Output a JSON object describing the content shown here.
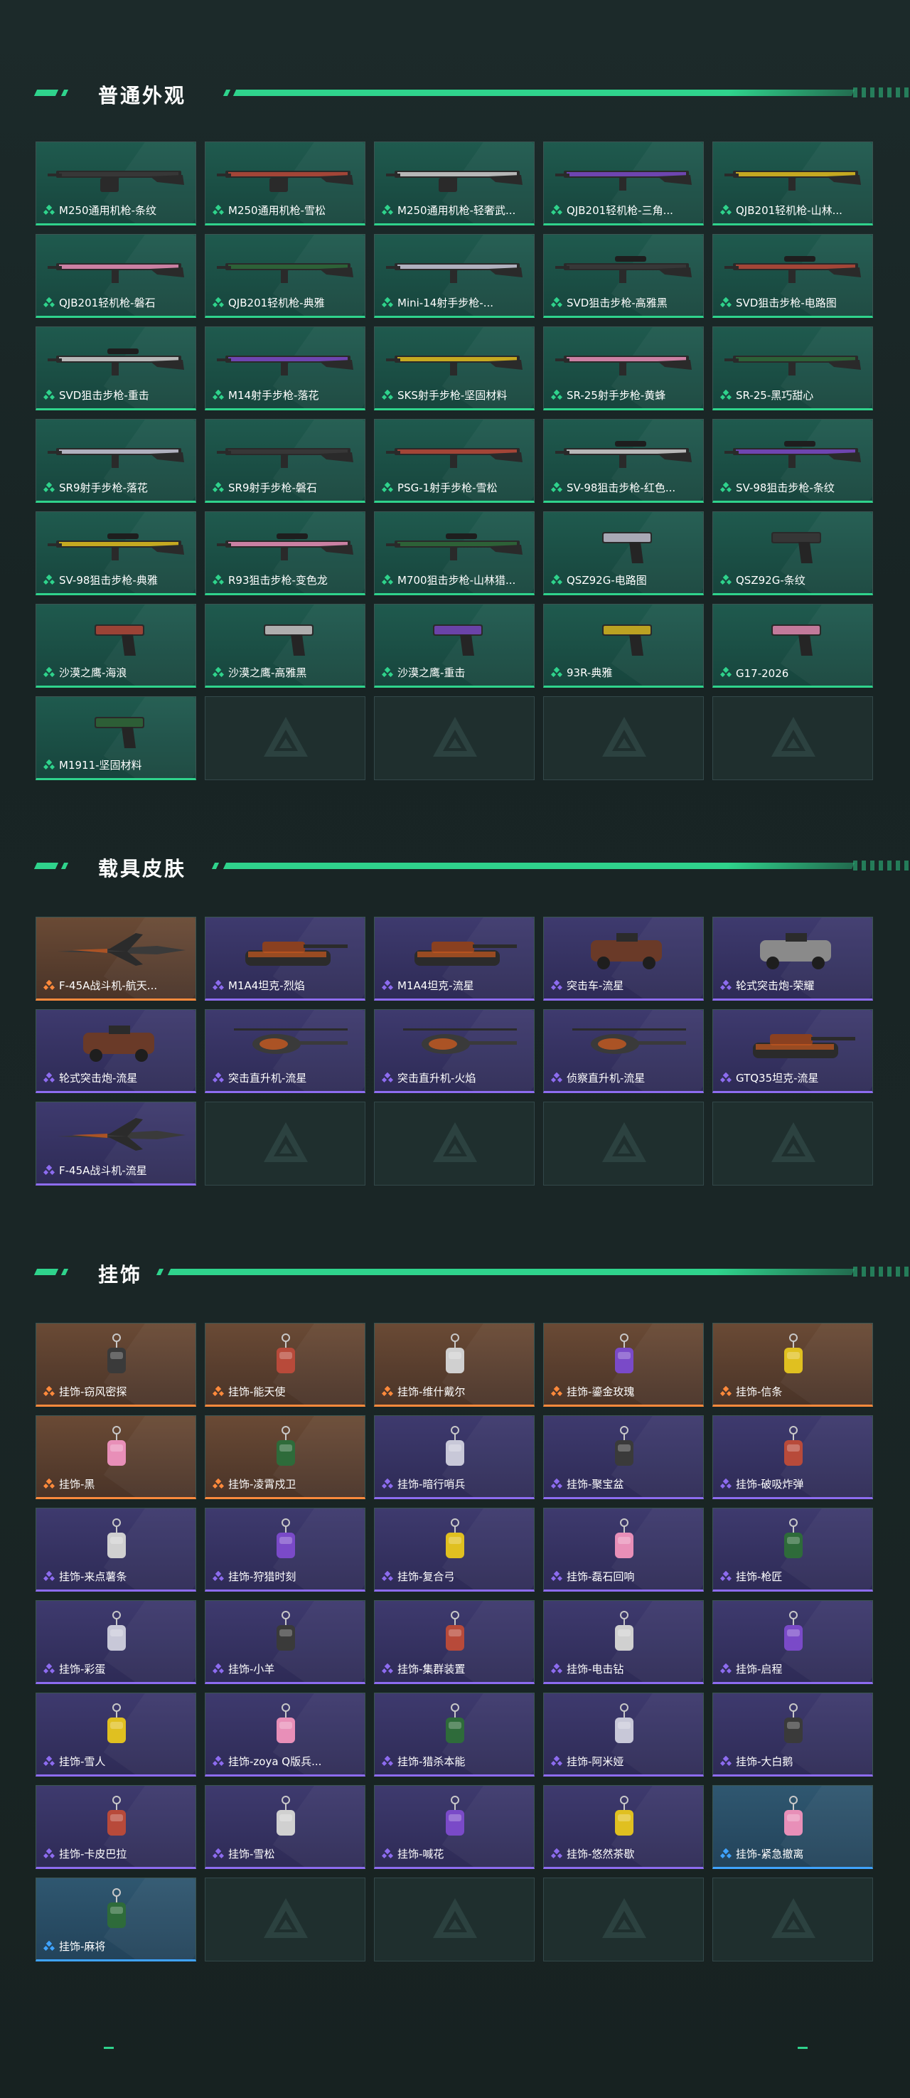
{
  "colors": {
    "accent": "#2fd38c",
    "green_card": "#1f5a4e",
    "purple_card": "#3e3a6e",
    "orange_card": "#6a4a35",
    "blue_card": "#2f5770"
  },
  "sections": [
    {
      "title": "普通外观",
      "items": [
        {
          "label": "M250通用机枪-条纹",
          "rarity": "green",
          "icon": "machine-gun-icon"
        },
        {
          "label": "M250通用机枪-雪松",
          "rarity": "green",
          "icon": "machine-gun-icon"
        },
        {
          "label": "M250通用机枪-轻奢武...",
          "rarity": "green",
          "icon": "machine-gun-icon"
        },
        {
          "label": "QJB201轻机枪-三角...",
          "rarity": "green",
          "icon": "light-machine-gun-icon"
        },
        {
          "label": "QJB201轻机枪-山林...",
          "rarity": "green",
          "icon": "light-machine-gun-icon"
        },
        {
          "label": "QJB201轻机枪-磐石",
          "rarity": "green",
          "icon": "light-machine-gun-icon"
        },
        {
          "label": "QJB201轻机枪-典雅",
          "rarity": "green",
          "icon": "light-machine-gun-icon"
        },
        {
          "label": "Mini-14射手步枪-...",
          "rarity": "green",
          "icon": "rifle-icon"
        },
        {
          "label": "SVD狙击步枪-高雅黑",
          "rarity": "green",
          "icon": "sniper-rifle-icon"
        },
        {
          "label": "SVD狙击步枪-电路图",
          "rarity": "green",
          "icon": "sniper-rifle-icon"
        },
        {
          "label": "SVD狙击步枪-重击",
          "rarity": "green",
          "icon": "sniper-rifle-icon"
        },
        {
          "label": "M14射手步枪-落花",
          "rarity": "green",
          "icon": "rifle-icon"
        },
        {
          "label": "SKS射手步枪-坚固材料",
          "rarity": "green",
          "icon": "rifle-icon"
        },
        {
          "label": "SR-25射手步枪-黄蜂",
          "rarity": "green",
          "icon": "rifle-icon"
        },
        {
          "label": "SR-25-黑巧甜心",
          "rarity": "green",
          "icon": "rifle-icon"
        },
        {
          "label": "SR9射手步枪-落花",
          "rarity": "green",
          "icon": "rifle-icon"
        },
        {
          "label": "SR9射手步枪-磐石",
          "rarity": "green",
          "icon": "rifle-icon"
        },
        {
          "label": "PSG-1射手步枪-雪松",
          "rarity": "green",
          "icon": "rifle-icon"
        },
        {
          "label": "SV-98狙击步枪-红色...",
          "rarity": "green",
          "icon": "sniper-rifle-icon"
        },
        {
          "label": "SV-98狙击步枪-条纹",
          "rarity": "green",
          "icon": "sniper-rifle-icon"
        },
        {
          "label": "SV-98狙击步枪-典雅",
          "rarity": "green",
          "icon": "sniper-rifle-icon"
        },
        {
          "label": "R93狙击步枪-变色龙",
          "rarity": "green",
          "icon": "sniper-rifle-icon"
        },
        {
          "label": "M700狙击步枪-山林猎...",
          "rarity": "green",
          "icon": "sniper-rifle-icon"
        },
        {
          "label": "QSZ92G-电路图",
          "rarity": "green",
          "icon": "pistol-icon"
        },
        {
          "label": "QSZ92G-条纹",
          "rarity": "green",
          "icon": "pistol-icon"
        },
        {
          "label": "沙漠之鹰-海浪",
          "rarity": "green",
          "icon": "pistol-icon"
        },
        {
          "label": "沙漠之鹰-高雅黑",
          "rarity": "green",
          "icon": "pistol-icon"
        },
        {
          "label": "沙漠之鹰-重击",
          "rarity": "green",
          "icon": "pistol-icon"
        },
        {
          "label": "93R-典雅",
          "rarity": "green",
          "icon": "pistol-icon"
        },
        {
          "label": "G17-2026",
          "rarity": "green",
          "icon": "pistol-icon"
        },
        {
          "label": "M1911-坚固材料",
          "rarity": "green",
          "icon": "pistol-icon"
        },
        {
          "label": "",
          "rarity": "empty"
        },
        {
          "label": "",
          "rarity": "empty"
        },
        {
          "label": "",
          "rarity": "empty"
        },
        {
          "label": "",
          "rarity": "empty"
        }
      ]
    },
    {
      "title": "载具皮肤",
      "items": [
        {
          "label": "F-45A战斗机-航天...",
          "rarity": "orange",
          "icon": "fighter-jet-icon"
        },
        {
          "label": "M1A4坦克-烈焰",
          "rarity": "purple",
          "icon": "tank-icon"
        },
        {
          "label": "M1A4坦克-流星",
          "rarity": "purple",
          "icon": "tank-icon"
        },
        {
          "label": "突击车-流星",
          "rarity": "purple",
          "icon": "assault-vehicle-icon"
        },
        {
          "label": "轮式突击炮-荣耀",
          "rarity": "purple",
          "icon": "wheeled-gun-icon"
        },
        {
          "label": "轮式突击炮-流星",
          "rarity": "purple",
          "icon": "wheeled-gun-icon"
        },
        {
          "label": "突击直升机-流星",
          "rarity": "purple",
          "icon": "helicopter-icon"
        },
        {
          "label": "突击直升机-火焰",
          "rarity": "purple",
          "icon": "helicopter-icon"
        },
        {
          "label": "侦察直升机-流星",
          "rarity": "purple",
          "icon": "helicopter-icon"
        },
        {
          "label": "GTQ35坦克-流星",
          "rarity": "purple",
          "icon": "tank-icon"
        },
        {
          "label": "F-45A战斗机-流星",
          "rarity": "purple",
          "icon": "fighter-jet-icon"
        },
        {
          "label": "",
          "rarity": "empty"
        },
        {
          "label": "",
          "rarity": "empty"
        },
        {
          "label": "",
          "rarity": "empty"
        },
        {
          "label": "",
          "rarity": "empty"
        }
      ]
    },
    {
      "title": "挂饰",
      "items": [
        {
          "label": "挂饰-窃风密探",
          "rarity": "orange",
          "icon": "charm-icon"
        },
        {
          "label": "挂饰-能天使",
          "rarity": "orange",
          "icon": "charm-icon"
        },
        {
          "label": "挂饰-维什戴尔",
          "rarity": "orange",
          "icon": "charm-icon"
        },
        {
          "label": "挂饰-鎏金玫瑰",
          "rarity": "orange",
          "icon": "charm-icon"
        },
        {
          "label": "挂饰-信条",
          "rarity": "orange",
          "icon": "charm-icon"
        },
        {
          "label": "挂饰-黑",
          "rarity": "orange",
          "icon": "charm-icon"
        },
        {
          "label": "挂饰-凌霄戍卫",
          "rarity": "orange",
          "icon": "charm-icon"
        },
        {
          "label": "挂饰-暗行哨兵",
          "rarity": "purple",
          "icon": "charm-icon"
        },
        {
          "label": "挂饰-聚宝盆",
          "rarity": "purple",
          "icon": "charm-icon"
        },
        {
          "label": "挂饰-破吸炸弹",
          "rarity": "purple",
          "icon": "charm-icon"
        },
        {
          "label": "挂饰-来点薯条",
          "rarity": "purple",
          "icon": "charm-icon"
        },
        {
          "label": "挂饰-狩猎时刻",
          "rarity": "purple",
          "icon": "charm-icon"
        },
        {
          "label": "挂饰-复合弓",
          "rarity": "purple",
          "icon": "charm-icon"
        },
        {
          "label": "挂饰-磊石回响",
          "rarity": "purple",
          "icon": "charm-icon"
        },
        {
          "label": "挂饰-枪匠",
          "rarity": "purple",
          "icon": "charm-icon"
        },
        {
          "label": "挂饰-彩蛋",
          "rarity": "purple",
          "icon": "charm-icon"
        },
        {
          "label": "挂饰-小羊",
          "rarity": "purple",
          "icon": "charm-icon"
        },
        {
          "label": "挂饰-集群装置",
          "rarity": "purple",
          "icon": "charm-icon"
        },
        {
          "label": "挂饰-电击钻",
          "rarity": "purple",
          "icon": "charm-icon"
        },
        {
          "label": "挂饰-启程",
          "rarity": "purple",
          "icon": "charm-icon"
        },
        {
          "label": "挂饰-雪人",
          "rarity": "purple",
          "icon": "charm-icon"
        },
        {
          "label": "挂饰-zoya Q版兵...",
          "rarity": "purple",
          "icon": "charm-icon"
        },
        {
          "label": "挂饰-猎杀本能",
          "rarity": "purple",
          "icon": "charm-icon"
        },
        {
          "label": "挂饰-阿米娅",
          "rarity": "purple",
          "icon": "charm-icon"
        },
        {
          "label": "挂饰-大白鹅",
          "rarity": "purple",
          "icon": "charm-icon"
        },
        {
          "label": "挂饰-卡皮巴拉",
          "rarity": "purple",
          "icon": "charm-icon"
        },
        {
          "label": "挂饰-雪松",
          "rarity": "purple",
          "icon": "charm-icon"
        },
        {
          "label": "挂饰-喊花",
          "rarity": "purple",
          "icon": "charm-icon"
        },
        {
          "label": "挂饰-悠然茶歇",
          "rarity": "purple",
          "icon": "charm-icon"
        },
        {
          "label": "挂饰-紧急撤离",
          "rarity": "blue",
          "icon": "charm-icon"
        },
        {
          "label": "挂饰-麻将",
          "rarity": "blue",
          "icon": "charm-icon"
        },
        {
          "label": "",
          "rarity": "empty"
        },
        {
          "label": "",
          "rarity": "empty"
        },
        {
          "label": "",
          "rarity": "empty"
        },
        {
          "label": "",
          "rarity": "empty"
        }
      ]
    }
  ]
}
